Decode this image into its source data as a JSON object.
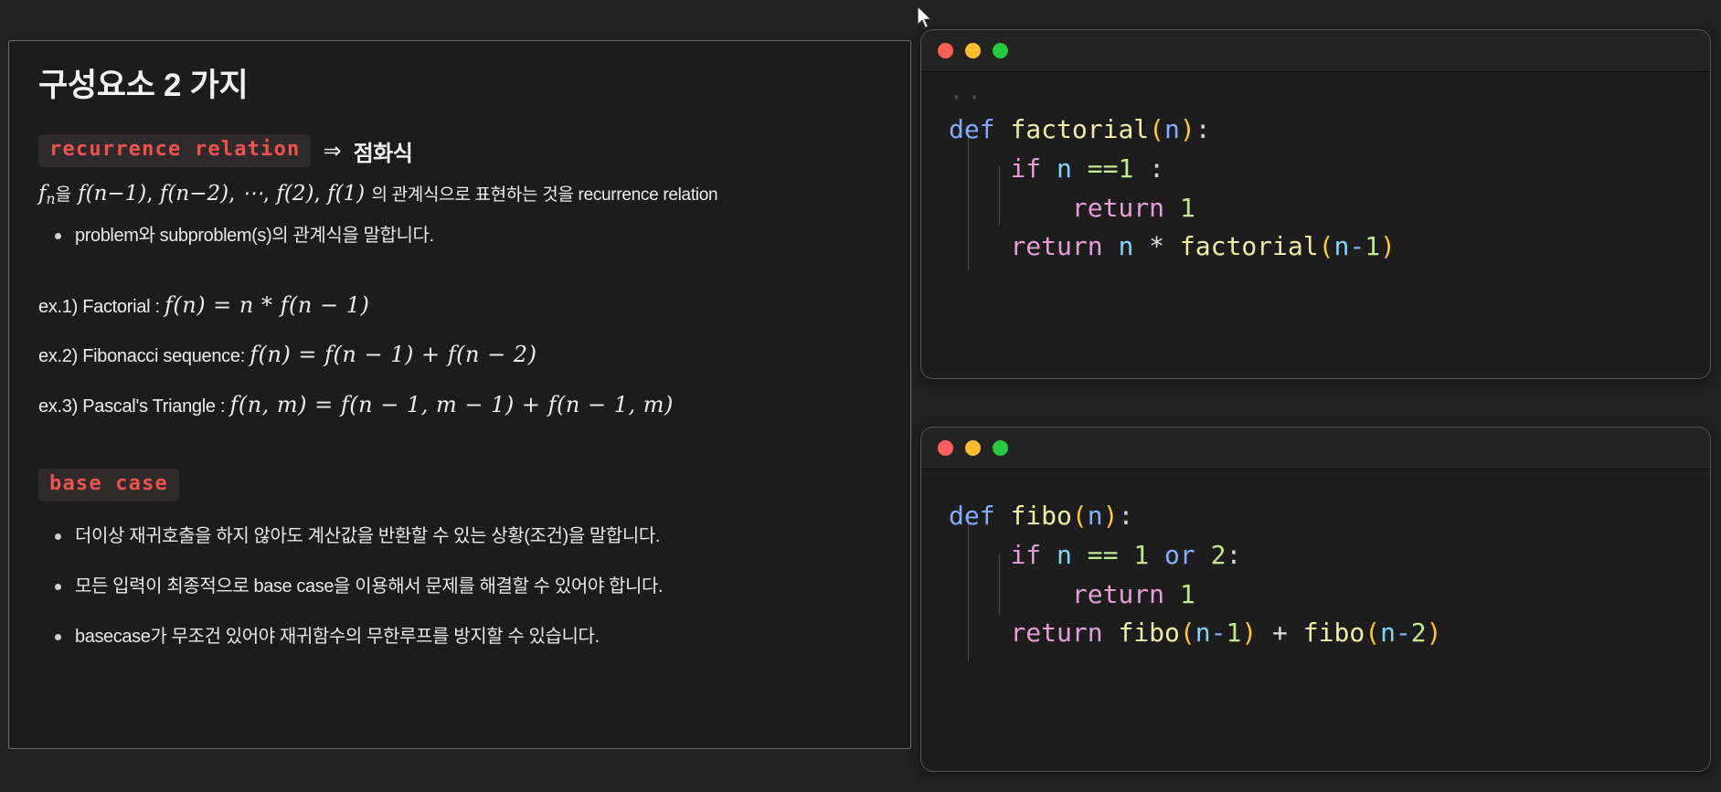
{
  "slide": {
    "title": "구성요소 2 가지",
    "section_recurrence": {
      "chip_label": "recurrence relation",
      "arrow": "⇒",
      "chip_after": "점화식",
      "definition": {
        "f_main": "f",
        "sub_main": "n",
        "korean_particle": "을",
        "terms": [
          "f(n−1)",
          "f(n−2)",
          "⋯",
          "f(2)",
          "f(1)"
        ],
        "tail": "의 관계식으로 표현하는 것을 recurrence relation"
      },
      "bullets": [
        "problem와 subproblem(s)의 관계식을 말합니다."
      ],
      "examples": [
        {
          "label": "ex.1) Factorial : ",
          "formula": "f(n) = n * f(n − 1)"
        },
        {
          "label": "ex.2) Fibonacci sequence: ",
          "formula": "f(n) = f(n − 1) + f(n − 2)"
        },
        {
          "label": "ex.3) Pascal's Triangle : ",
          "formula": "f(n, m) = f(n − 1, m − 1) + f(n − 1, m)"
        }
      ]
    },
    "section_base_case": {
      "chip_label": "base case",
      "bullets": [
        "더이상 재귀호출을 하지 않아도 계산값을 반환할 수 있는 상황(조건)을 말합니다.",
        "모든 입력이 최종적으로 base case을 이용해서 문제를 해결할 수 있어야 합니다.",
        "basecase가 무조건 있어야 재귀함수의 무한루프를 방지할 수 있습니다."
      ]
    }
  },
  "code_windows": [
    {
      "traffic_lights": [
        "close-red",
        "minimize-yellow",
        "maximize-green"
      ],
      "language": "python",
      "function_name": "factorial",
      "code_text": "def factorial(n):\n    if n ==1 :\n        return 1\n    return n * factorial(n-1)",
      "lines": [
        {
          "tokens": [
            {
              "t": "def",
              "c": "t-kw"
            },
            {
              "t": " ",
              "c": "t-punc"
            },
            {
              "t": "factorial",
              "c": "t-fn"
            },
            {
              "t": "(",
              "c": "t-paren"
            },
            {
              "t": "n",
              "c": "t-param"
            },
            {
              "t": ")",
              "c": "t-paren"
            },
            {
              "t": ":",
              "c": "t-punc"
            }
          ]
        },
        {
          "tokens": [
            {
              "t": "    ",
              "c": "t-punc"
            },
            {
              "t": "if",
              "c": "t-ctrl"
            },
            {
              "t": " ",
              "c": "t-punc"
            },
            {
              "t": "n",
              "c": "t-var"
            },
            {
              "t": " ",
              "c": "t-punc"
            },
            {
              "t": "==",
              "c": "t-op"
            },
            {
              "t": "1",
              "c": "t-num"
            },
            {
              "t": " ",
              "c": "t-punc"
            },
            {
              "t": ":",
              "c": "t-punc"
            }
          ]
        },
        {
          "tokens": [
            {
              "t": "        ",
              "c": "t-punc"
            },
            {
              "t": "return",
              "c": "t-ctrl"
            },
            {
              "t": " ",
              "c": "t-punc"
            },
            {
              "t": "1",
              "c": "t-num"
            }
          ]
        },
        {
          "tokens": [
            {
              "t": "    ",
              "c": "t-punc"
            },
            {
              "t": "return",
              "c": "t-ctrl"
            },
            {
              "t": " ",
              "c": "t-punc"
            },
            {
              "t": "n",
              "c": "t-var"
            },
            {
              "t": " ",
              "c": "t-punc"
            },
            {
              "t": "*",
              "c": "t-star"
            },
            {
              "t": " ",
              "c": "t-punc"
            },
            {
              "t": "factorial",
              "c": "t-fn"
            },
            {
              "t": "(",
              "c": "t-paren"
            },
            {
              "t": "n",
              "c": "t-var"
            },
            {
              "t": "-",
              "c": "t-dash"
            },
            {
              "t": "1",
              "c": "t-num"
            },
            {
              "t": ")",
              "c": "t-paren"
            }
          ]
        }
      ]
    },
    {
      "traffic_lights": [
        "close-red",
        "minimize-yellow",
        "maximize-green"
      ],
      "language": "python",
      "function_name": "fibo",
      "code_text": "def fibo(n):\n    if n == 1 or 2:\n        return 1\n    return fibo(n-1) + fibo(n-2)",
      "lines": [
        {
          "tokens": [
            {
              "t": "def",
              "c": "t-kw"
            },
            {
              "t": " ",
              "c": "t-punc"
            },
            {
              "t": "fibo",
              "c": "t-fn"
            },
            {
              "t": "(",
              "c": "t-paren"
            },
            {
              "t": "n",
              "c": "t-param"
            },
            {
              "t": ")",
              "c": "t-paren"
            },
            {
              "t": ":",
              "c": "t-punc"
            }
          ]
        },
        {
          "tokens": [
            {
              "t": "    ",
              "c": "t-punc"
            },
            {
              "t": "if",
              "c": "t-ctrl"
            },
            {
              "t": " ",
              "c": "t-punc"
            },
            {
              "t": "n",
              "c": "t-var"
            },
            {
              "t": " ",
              "c": "t-punc"
            },
            {
              "t": "==",
              "c": "t-op"
            },
            {
              "t": " ",
              "c": "t-punc"
            },
            {
              "t": "1",
              "c": "t-num"
            },
            {
              "t": " ",
              "c": "t-punc"
            },
            {
              "t": "or",
              "c": "t-logic"
            },
            {
              "t": " ",
              "c": "t-punc"
            },
            {
              "t": "2",
              "c": "t-num"
            },
            {
              "t": ":",
              "c": "t-punc"
            }
          ]
        },
        {
          "tokens": [
            {
              "t": "        ",
              "c": "t-punc"
            },
            {
              "t": "return",
              "c": "t-ctrl"
            },
            {
              "t": " ",
              "c": "t-punc"
            },
            {
              "t": "1",
              "c": "t-num"
            }
          ]
        },
        {
          "tokens": [
            {
              "t": "    ",
              "c": "t-punc"
            },
            {
              "t": "return",
              "c": "t-ctrl"
            },
            {
              "t": " ",
              "c": "t-punc"
            },
            {
              "t": "fibo",
              "c": "t-fn"
            },
            {
              "t": "(",
              "c": "t-paren"
            },
            {
              "t": "n",
              "c": "t-var"
            },
            {
              "t": "-",
              "c": "t-dash"
            },
            {
              "t": "1",
              "c": "t-num"
            },
            {
              "t": ")",
              "c": "t-paren"
            },
            {
              "t": " ",
              "c": "t-punc"
            },
            {
              "t": "+",
              "c": "t-plus"
            },
            {
              "t": " ",
              "c": "t-punc"
            },
            {
              "t": "fibo",
              "c": "t-fn"
            },
            {
              "t": "(",
              "c": "t-paren"
            },
            {
              "t": "n",
              "c": "t-var"
            },
            {
              "t": "-",
              "c": "t-dash"
            },
            {
              "t": "2",
              "c": "t-num"
            },
            {
              "t": ")",
              "c": "t-paren"
            }
          ]
        }
      ]
    }
  ],
  "colors": {
    "page_background": "#212121",
    "panel_background": "#1c1c1c",
    "panel_border": "#6e6e6e",
    "code_background": "#1d1d1d",
    "titlebar_background": "#232323",
    "chip_background": "#2e2b2a",
    "chip_text": "#ef5350",
    "traffic_red": "#ff5f56",
    "traffic_yellow": "#ffbd2e",
    "traffic_green": "#27c93f"
  }
}
